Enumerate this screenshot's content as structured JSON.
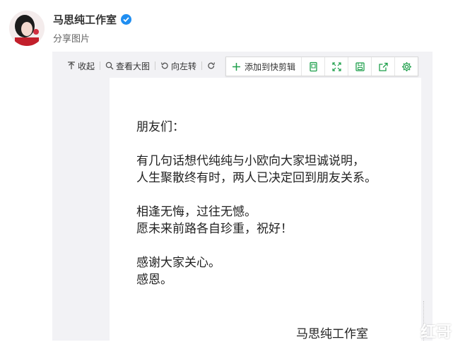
{
  "header": {
    "username": "马思纯工作室",
    "share_text": "分享图片"
  },
  "toolbar": {
    "collapse_label": "收起",
    "view_large_label": "查看大图",
    "rotate_left_label": "向左转",
    "rotate_right_label": "向右转",
    "quick_edit_label": "添加到快剪辑"
  },
  "letter": {
    "lines": [
      "朋友们：",
      "",
      "有几句话想代纯纯与小欧向大家坦诚说明，",
      "人生聚散终有时，两人已决定回到朋友关系。",
      "",
      "相逢无悔，过往无憾。",
      "愿未来前路各自珍重，祝好！",
      "",
      "感谢大家关心。",
      "感恩。"
    ],
    "signature": "马思纯工作室"
  },
  "watermark": "红哥",
  "colors": {
    "accent": "#1e9f4b",
    "verified": "#1f8ef1",
    "viewer_bg": "#f2f2f5"
  }
}
